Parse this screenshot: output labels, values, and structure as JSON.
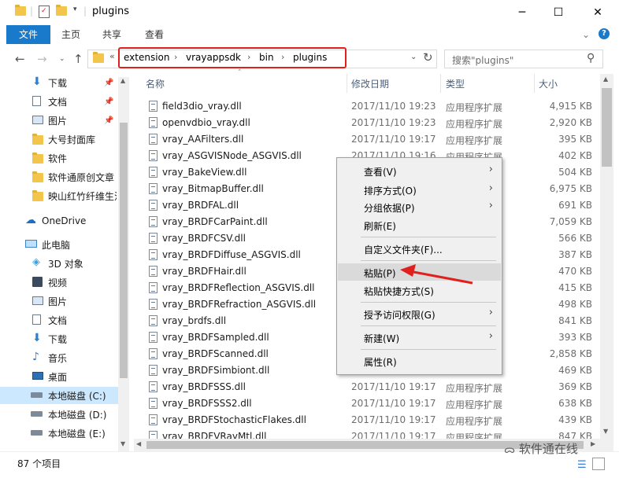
{
  "window": {
    "title": "plugins",
    "minimize": "─",
    "maximize": "☐",
    "close": "✕"
  },
  "ribbon": {
    "tabs": [
      "文件",
      "主页",
      "共享",
      "查看"
    ],
    "collapse": "⌄",
    "help": "?"
  },
  "address": {
    "overflow": "«",
    "crumbs": [
      "extension",
      "vrayappsdk",
      "bin",
      "plugins"
    ],
    "refresh": "↻",
    "search_placeholder": "搜索\"plugins\""
  },
  "nav": {
    "quick": [
      {
        "label": "下载",
        "icon": "download-icon",
        "pinned": true
      },
      {
        "label": "文档",
        "icon": "document-icon",
        "pinned": true
      },
      {
        "label": "图片",
        "icon": "picture-icon",
        "pinned": true
      },
      {
        "label": "大号封面库",
        "icon": "folder-icon",
        "pinned": false
      },
      {
        "label": "软件",
        "icon": "folder-icon",
        "pinned": false
      },
      {
        "label": "软件通原创文章",
        "icon": "folder-icon",
        "pinned": false
      },
      {
        "label": "映山红竹纤维生活",
        "icon": "folder-icon",
        "pinned": false
      }
    ],
    "onedrive": "OneDrive",
    "thispc": "此电脑",
    "pc_items": [
      {
        "label": "3D 对象",
        "icon": "3d-objects-icon"
      },
      {
        "label": "视频",
        "icon": "video-icon"
      },
      {
        "label": "图片",
        "icon": "picture-icon"
      },
      {
        "label": "文档",
        "icon": "document-icon"
      },
      {
        "label": "下载",
        "icon": "download-icon"
      },
      {
        "label": "音乐",
        "icon": "music-icon"
      },
      {
        "label": "桌面",
        "icon": "desktop-icon"
      },
      {
        "label": "本地磁盘 (C:)",
        "icon": "drive-c-icon",
        "selected": true
      },
      {
        "label": "本地磁盘 (D:)",
        "icon": "drive-icon"
      },
      {
        "label": "本地磁盘 (E:)",
        "icon": "drive-icon"
      }
    ]
  },
  "columns": {
    "name": "名称",
    "date": "修改日期",
    "type": "类型",
    "size": "大小"
  },
  "files": [
    {
      "name": "field3dio_vray.dll",
      "date": "2017/11/10 19:23",
      "type": "应用程序扩展",
      "size": "4,915 KB"
    },
    {
      "name": "openvdbio_vray.dll",
      "date": "2017/11/10 19:23",
      "type": "应用程序扩展",
      "size": "2,920 KB"
    },
    {
      "name": "vray_AAFilters.dll",
      "date": "2017/11/10 19:17",
      "type": "应用程序扩展",
      "size": "395 KB"
    },
    {
      "name": "vray_ASGVISNode_ASGVIS.dll",
      "date": "2017/11/10 19:16",
      "type": "应用程序扩展",
      "size": "402 KB"
    },
    {
      "name": "vray_BakeView.dll",
      "date": "",
      "type": "",
      "size": "504 KB"
    },
    {
      "name": "vray_BitmapBuffer.dll",
      "date": "",
      "type": "",
      "size": "6,975 KB"
    },
    {
      "name": "vray_BRDFAL.dll",
      "date": "",
      "type": "",
      "size": "691 KB"
    },
    {
      "name": "vray_BRDFCarPaint.dll",
      "date": "",
      "type": "",
      "size": "7,059 KB"
    },
    {
      "name": "vray_BRDFCSV.dll",
      "date": "",
      "type": "",
      "size": "566 KB"
    },
    {
      "name": "vray_BRDFDiffuse_ASGVIS.dll",
      "date": "",
      "type": "",
      "size": "387 KB"
    },
    {
      "name": "vray_BRDFHair.dll",
      "date": "",
      "type": "",
      "size": "470 KB"
    },
    {
      "name": "vray_BRDFReflection_ASGVIS.dll",
      "date": "",
      "type": "",
      "size": "415 KB"
    },
    {
      "name": "vray_BRDFRefraction_ASGVIS.dll",
      "date": "",
      "type": "",
      "size": "498 KB"
    },
    {
      "name": "vray_brdfs.dll",
      "date": "",
      "type": "",
      "size": "841 KB"
    },
    {
      "name": "vray_BRDFSampled.dll",
      "date": "",
      "type": "",
      "size": "393 KB"
    },
    {
      "name": "vray_BRDFScanned.dll",
      "date": "",
      "type": "",
      "size": "2,858 KB"
    },
    {
      "name": "vray_BRDFSimbiont.dll",
      "date": "",
      "type": "",
      "size": "469 KB"
    },
    {
      "name": "vray_BRDFSSS.dll",
      "date": "2017/11/10 19:17",
      "type": "应用程序扩展",
      "size": "369 KB"
    },
    {
      "name": "vray_BRDFSSS2.dll",
      "date": "2017/11/10 19:17",
      "type": "应用程序扩展",
      "size": "638 KB"
    },
    {
      "name": "vray_BRDFStochasticFlakes.dll",
      "date": "2017/11/10 19:17",
      "type": "应用程序扩展",
      "size": "439 KB"
    },
    {
      "name": "vray_BRDFVRayMtl.dll",
      "date": "2017/11/10 19:17",
      "type": "应用程序扩展",
      "size": "847 KB"
    }
  ],
  "context_menu": [
    {
      "label": "查看(V)",
      "submenu": true
    },
    {
      "label": "排序方式(O)",
      "submenu": true
    },
    {
      "label": "分组依据(P)",
      "submenu": true
    },
    {
      "label": "刷新(E)",
      "submenu": false
    },
    {
      "label": "自定义文件夹(F)...",
      "submenu": false
    },
    {
      "label": "粘贴(P)",
      "submenu": false,
      "highlighted": true
    },
    {
      "label": "粘贴快捷方式(S)",
      "submenu": false
    },
    {
      "label": "授予访问权限(G)",
      "submenu": true
    },
    {
      "label": "新建(W)",
      "submenu": true
    },
    {
      "label": "属性(R)",
      "submenu": false
    }
  ],
  "status": {
    "count": "87 个项目"
  },
  "watermark": "软件通在线",
  "colors": {
    "accent": "#1979ca",
    "highlight_box": "#e0201c",
    "selected_nav": "#cce8ff",
    "arrow": "#e0201c"
  }
}
